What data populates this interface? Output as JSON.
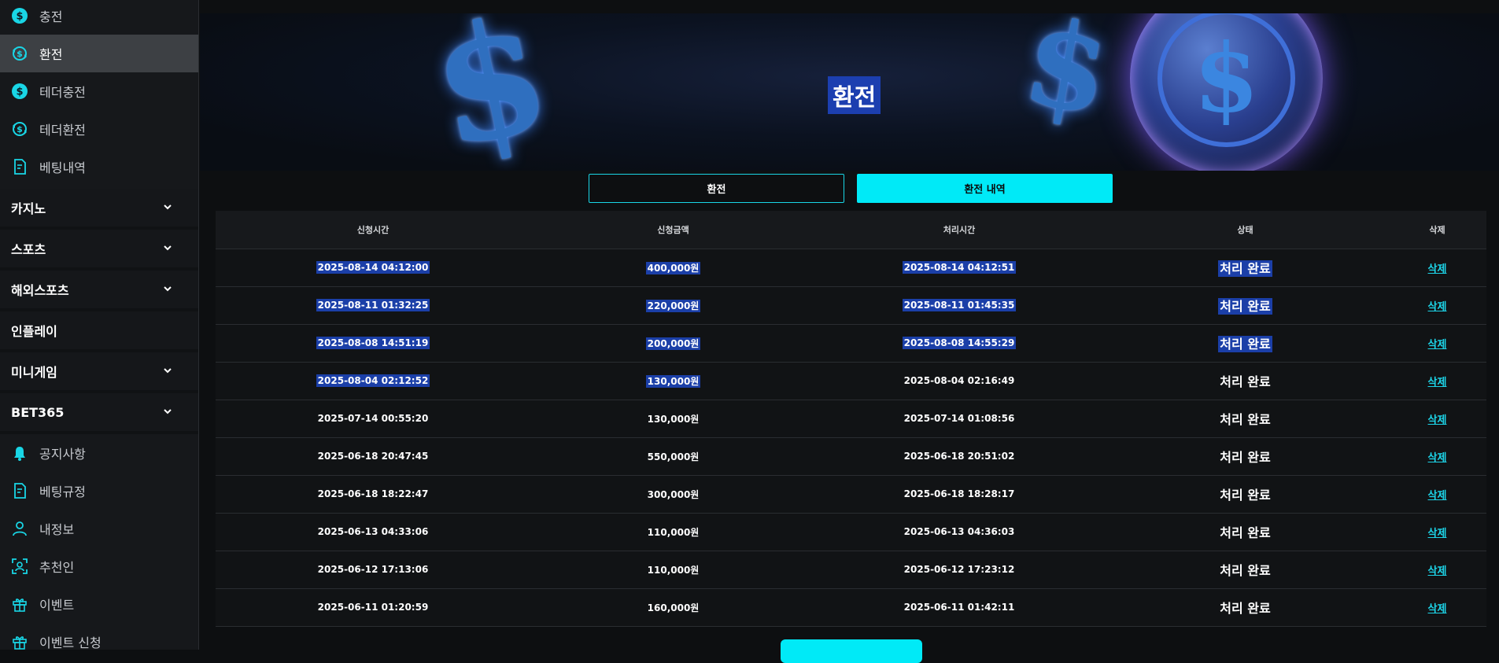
{
  "sidebar": {
    "top_items": [
      {
        "label": "충전",
        "icon": "dollar-coin-icon"
      },
      {
        "label": "환전",
        "icon": "exchange-coin-icon",
        "active": true
      },
      {
        "label": "테더충전",
        "icon": "dollar-coin-icon"
      },
      {
        "label": "테더환전",
        "icon": "exchange-coin-icon"
      },
      {
        "label": "베팅내역",
        "icon": "receipt-icon"
      }
    ],
    "categories": [
      {
        "label": "카지노",
        "has_chevron": true
      },
      {
        "label": "스포츠",
        "has_chevron": true
      },
      {
        "label": "해외스포츠",
        "has_chevron": true
      },
      {
        "label": "인플레이",
        "has_chevron": false
      },
      {
        "label": "미니게임",
        "has_chevron": true
      },
      {
        "label": "BET365",
        "has_chevron": true
      }
    ],
    "bottom_items": [
      {
        "label": "공지사항",
        "icon": "bell-icon"
      },
      {
        "label": "베팅규정",
        "icon": "receipt-icon"
      },
      {
        "label": "내정보",
        "icon": "user-icon"
      },
      {
        "label": "추천인",
        "icon": "scan-user-icon"
      },
      {
        "label": "이벤트",
        "icon": "gift-icon"
      },
      {
        "label": "이벤트 신청",
        "icon": "gift-icon"
      }
    ]
  },
  "banner": {
    "title": "환전"
  },
  "tabs": {
    "withdraw": "환전",
    "history": "환전 내역"
  },
  "table": {
    "headers": [
      "신청시간",
      "신청금액",
      "처리시간",
      "상태",
      "삭제"
    ],
    "rows": [
      {
        "requested": "2025-08-14 04:12:00",
        "amount": "400,000원",
        "processed": "2025-08-14 04:12:51",
        "status": "처리 완료",
        "delete": "삭제",
        "hl_req": true,
        "hl_amt": true,
        "hl_proc": true,
        "hl_status": true
      },
      {
        "requested": "2025-08-11 01:32:25",
        "amount": "220,000원",
        "processed": "2025-08-11 01:45:35",
        "status": "처리 완료",
        "delete": "삭제",
        "hl_req": true,
        "hl_amt": true,
        "hl_proc": true,
        "hl_status": true
      },
      {
        "requested": "2025-08-08 14:51:19",
        "amount": "200,000원",
        "processed": "2025-08-08 14:55:29",
        "status": "처리 완료",
        "delete": "삭제",
        "hl_req": true,
        "hl_amt": true,
        "hl_proc": true,
        "hl_status": true
      },
      {
        "requested": "2025-08-04 02:12:52",
        "amount": "130,000원",
        "processed": "2025-08-04 02:16:49",
        "status": "처리 완료",
        "delete": "삭제",
        "hl_req": true,
        "hl_amt": true,
        "hl_proc": false,
        "hl_status": false
      },
      {
        "requested": "2025-07-14 00:55:20",
        "amount": "130,000원",
        "processed": "2025-07-14 01:08:56",
        "status": "처리 완료",
        "delete": "삭제"
      },
      {
        "requested": "2025-06-18 20:47:45",
        "amount": "550,000원",
        "processed": "2025-06-18 20:51:02",
        "status": "처리 완료",
        "delete": "삭제"
      },
      {
        "requested": "2025-06-18 18:22:47",
        "amount": "300,000원",
        "processed": "2025-06-18 18:28:17",
        "status": "처리 완료",
        "delete": "삭제"
      },
      {
        "requested": "2025-06-13 04:33:06",
        "amount": "110,000원",
        "processed": "2025-06-13 04:36:03",
        "status": "처리 완료",
        "delete": "삭제"
      },
      {
        "requested": "2025-06-12 17:13:06",
        "amount": "110,000원",
        "processed": "2025-06-12 17:23:12",
        "status": "처리 완료",
        "delete": "삭제"
      },
      {
        "requested": "2025-06-11 01:20:59",
        "amount": "160,000원",
        "processed": "2025-06-11 01:42:11",
        "status": "처리 완료",
        "delete": "삭제"
      }
    ]
  },
  "colors": {
    "accent": "#00eaf7",
    "selection": "#1b3fa8",
    "sidebar_bg": "#16181b"
  }
}
